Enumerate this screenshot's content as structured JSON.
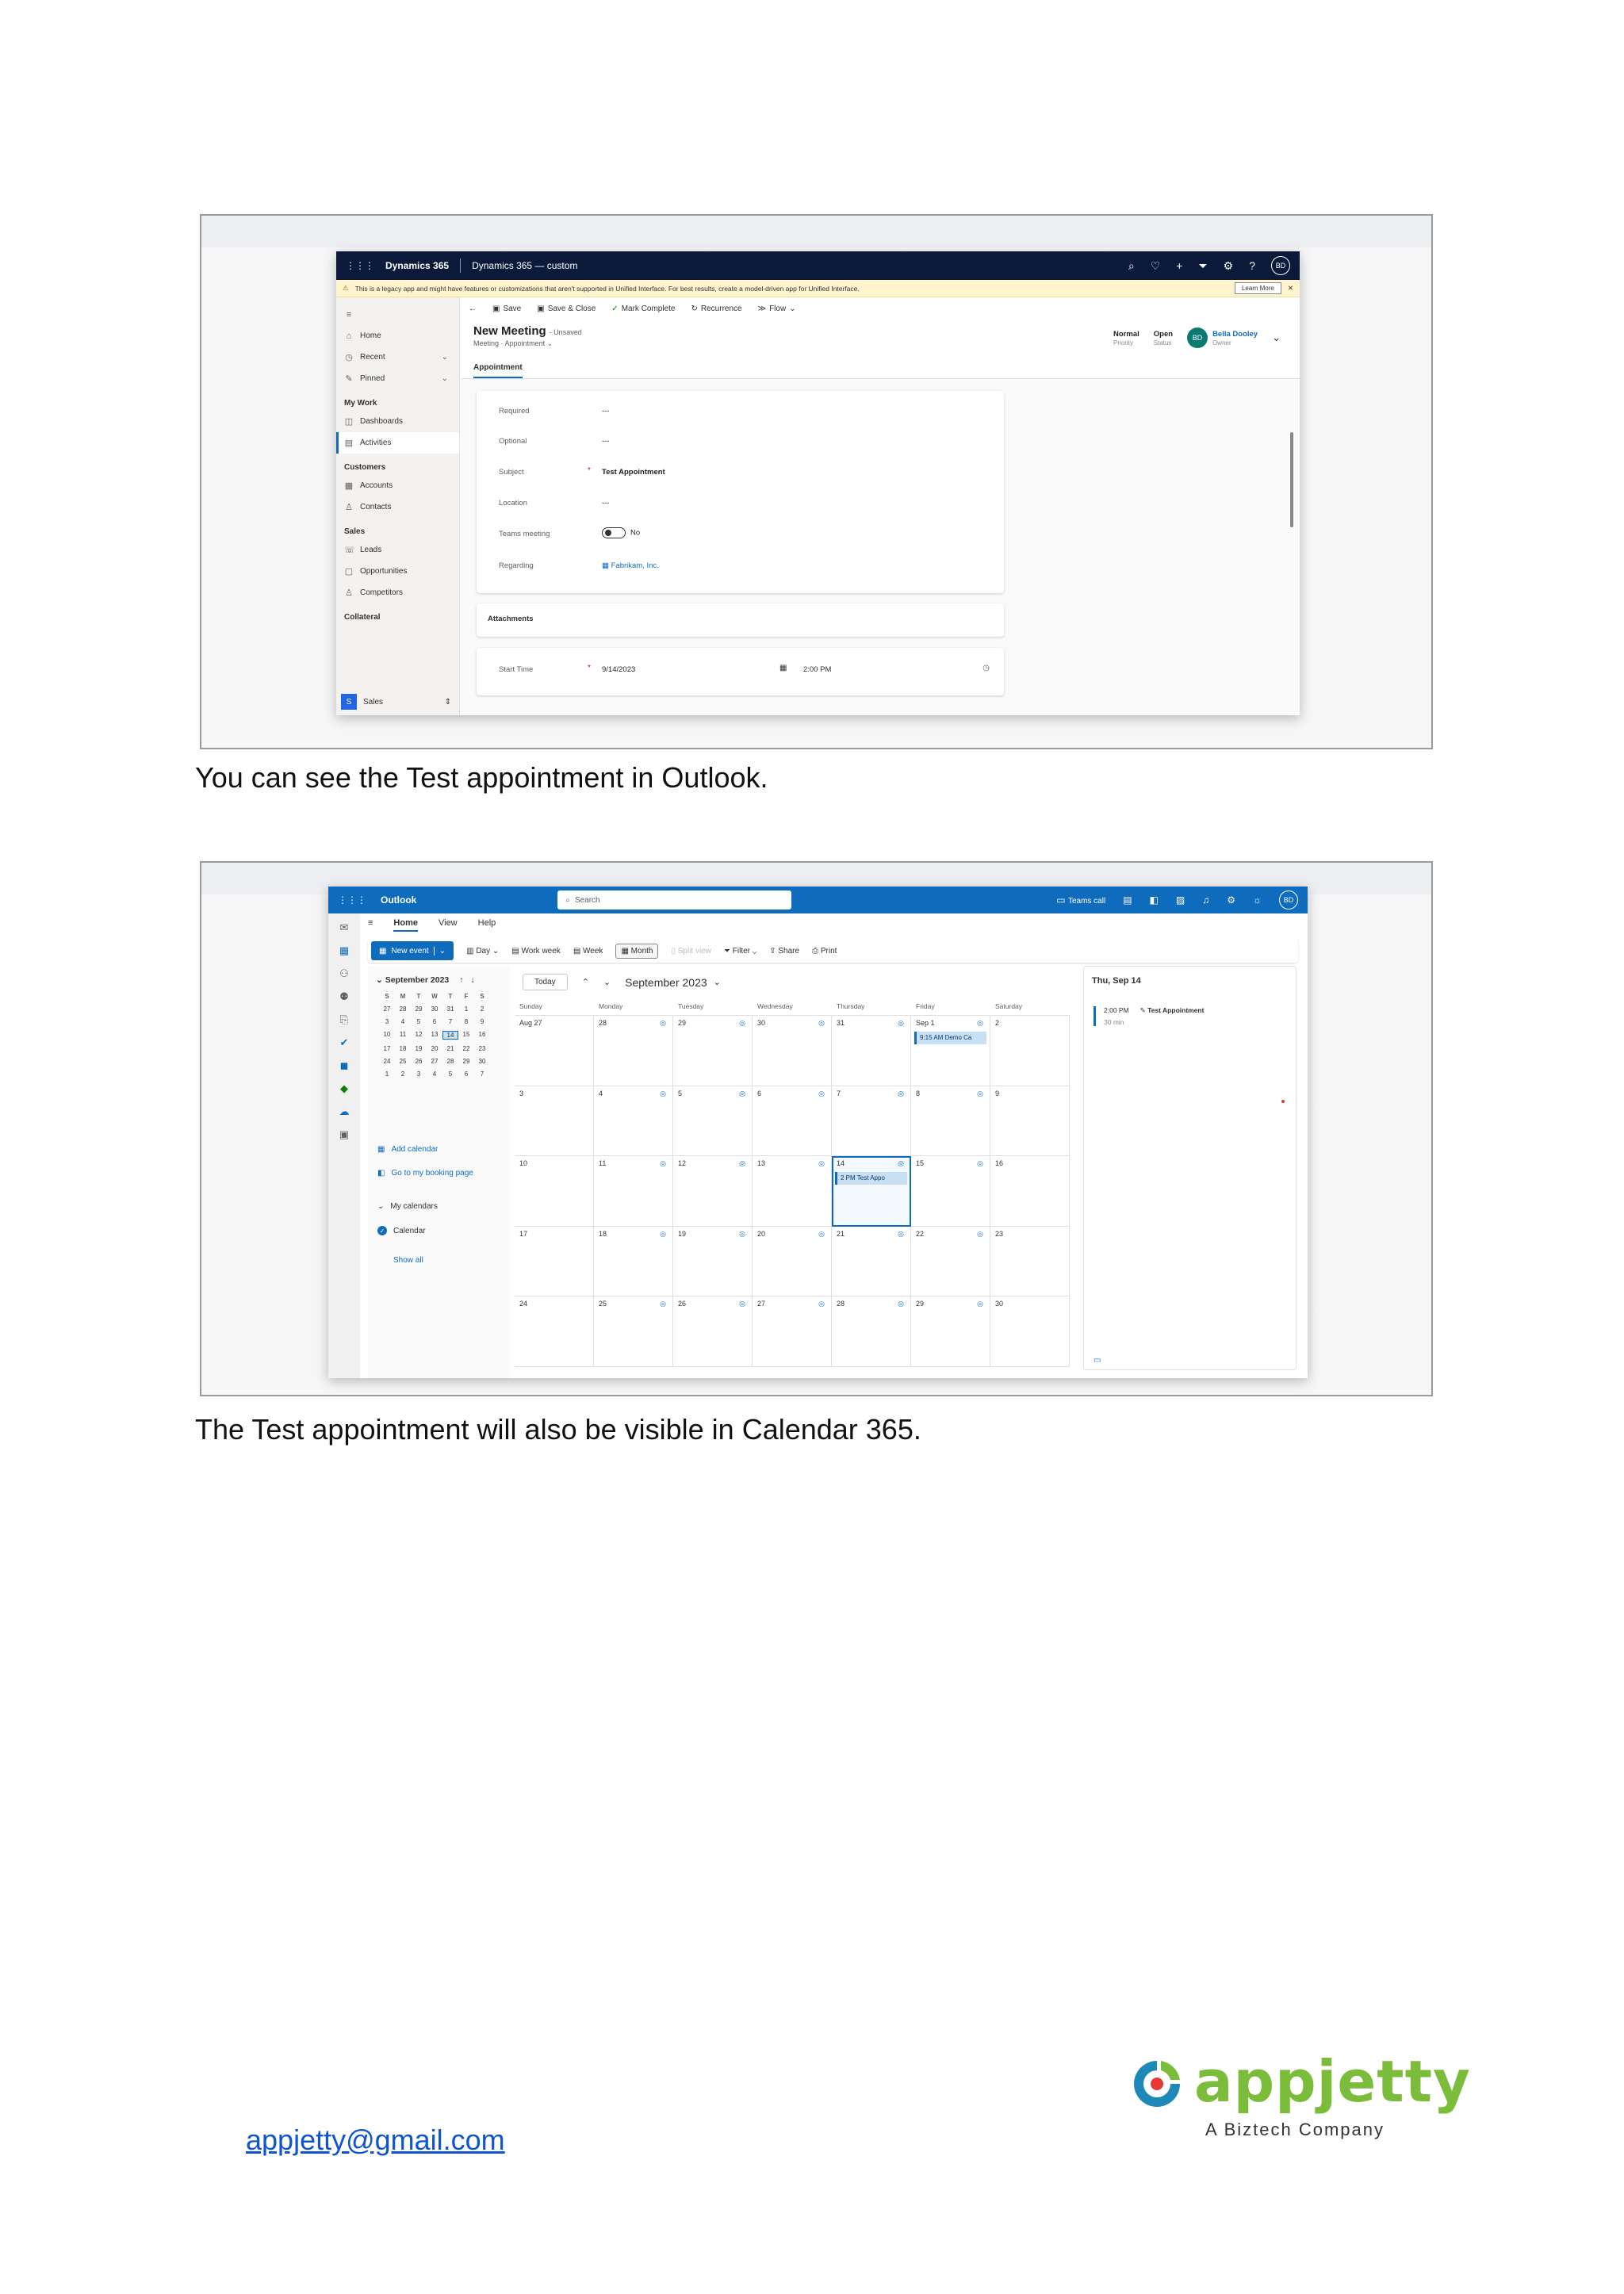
{
  "dynamics": {
    "app_name": "Dynamics 365",
    "env_name": "Dynamics 365 — custom",
    "avatar": "BD",
    "warning_text": "This is a legacy app and might have features or customizations that aren't supported in Unified Interface. For best results, create a model-driven app for Unified Interface.",
    "learn_more": "Learn More",
    "nav": {
      "home": "Home",
      "recent": "Recent",
      "pinned": "Pinned",
      "my_work_head": "My Work",
      "dashboards": "Dashboards",
      "activities": "Activities",
      "customers_head": "Customers",
      "accounts": "Accounts",
      "contacts": "Contacts",
      "sales_head": "Sales",
      "leads": "Leads",
      "opportunities": "Opportunities",
      "competitors": "Competitors",
      "collateral_head": "Collateral",
      "area_badge": "S",
      "area_name": "Sales"
    },
    "commands": {
      "save": "Save",
      "save_close": "Save & Close",
      "mark_complete": "Mark Complete",
      "recurrence": "Recurrence",
      "flow": "Flow"
    },
    "record": {
      "title": "New Meeting",
      "state": "- Unsaved",
      "entity": "Meeting",
      "form": "Appointment",
      "tab": "Appointment",
      "priority_value": "Normal",
      "priority_label": "Priority",
      "status_value": "Open",
      "status_label": "Status",
      "owner_initials": "BD",
      "owner_name": "Bella Dooley",
      "owner_label": "Owner"
    },
    "fields": {
      "required_label": "Required",
      "required_value": "---",
      "optional_label": "Optional",
      "optional_value": "---",
      "subject_label": "Subject",
      "subject_value": "Test Appointment",
      "location_label": "Location",
      "location_value": "---",
      "teams_label": "Teams meeting",
      "teams_value": "No",
      "regarding_label": "Regarding",
      "regarding_value": "Fabrikam, Inc.",
      "attachments": "Attachments",
      "start_label": "Start Time",
      "start_date": "9/14/2023",
      "start_time": "2:00 PM"
    }
  },
  "caption1": "You can see the Test appointment in Outlook.",
  "outlook": {
    "app_name": "Outlook",
    "search_placeholder": "Search",
    "teams_call": "Teams call",
    "avatar": "BD",
    "tabs": {
      "home": "Home",
      "view": "View",
      "help": "Help"
    },
    "ribbon": {
      "new_event": "New event",
      "day": "Day",
      "work_week": "Work week",
      "week": "Week",
      "month": "Month",
      "split_view": "Split view",
      "filter": "Filter",
      "share": "Share",
      "print": "Print"
    },
    "mini_calendar": {
      "title": "September 2023",
      "weekdays": [
        "S",
        "M",
        "T",
        "W",
        "T",
        "F",
        "S"
      ],
      "days": [
        "27",
        "28",
        "29",
        "30",
        "31",
        "1",
        "2",
        "3",
        "4",
        "5",
        "6",
        "7",
        "8",
        "9",
        "10",
        "11",
        "12",
        "13",
        "14",
        "15",
        "16",
        "17",
        "18",
        "19",
        "20",
        "21",
        "22",
        "23",
        "24",
        "25",
        "26",
        "27",
        "28",
        "29",
        "30",
        "1",
        "2",
        "3",
        "4",
        "5",
        "6",
        "7"
      ],
      "today_index": 18
    },
    "side": {
      "add_calendar": "Add calendar",
      "booking_page": "Go to my booking page",
      "my_calendars": "My calendars",
      "calendar": "Calendar",
      "show_all": "Show all"
    },
    "calendar": {
      "today_btn": "Today",
      "month_title": "September 2023",
      "weekdays": [
        "Sunday",
        "Monday",
        "Tuesday",
        "Wednesday",
        "Thursday",
        "Friday",
        "Saturday"
      ],
      "cells": [
        "Aug 27",
        "28",
        "29",
        "30",
        "31",
        "Sep 1",
        "2",
        "3",
        "4",
        "5",
        "6",
        "7",
        "8",
        "9",
        "10",
        "11",
        "12",
        "13",
        "14",
        "15",
        "16",
        "17",
        "18",
        "19",
        "20",
        "21",
        "22",
        "23",
        "24",
        "25",
        "26",
        "27",
        "28",
        "29",
        "30"
      ],
      "event_demo": "9:15 AM Demo Ca",
      "event_test": "2 PM Test Appo"
    },
    "agenda": {
      "date": "Thu, Sep 14",
      "time": "2:00 PM",
      "title": "Test Appointment",
      "duration": "30 min"
    }
  },
  "caption2": "The Test appointment will also be visible in Calendar 365.",
  "footer": {
    "email": "appjetty@gmail.com",
    "logo_word": "appjetty",
    "logo_tagline": "A Biztech Company"
  },
  "colors": {
    "dynamics_bar": "#0b1a3b",
    "outlook_blue": "#0f6cbd",
    "logo_green": "#7bbd3a",
    "logo_red": "#e53935",
    "logo_teal": "#1e88b8"
  }
}
